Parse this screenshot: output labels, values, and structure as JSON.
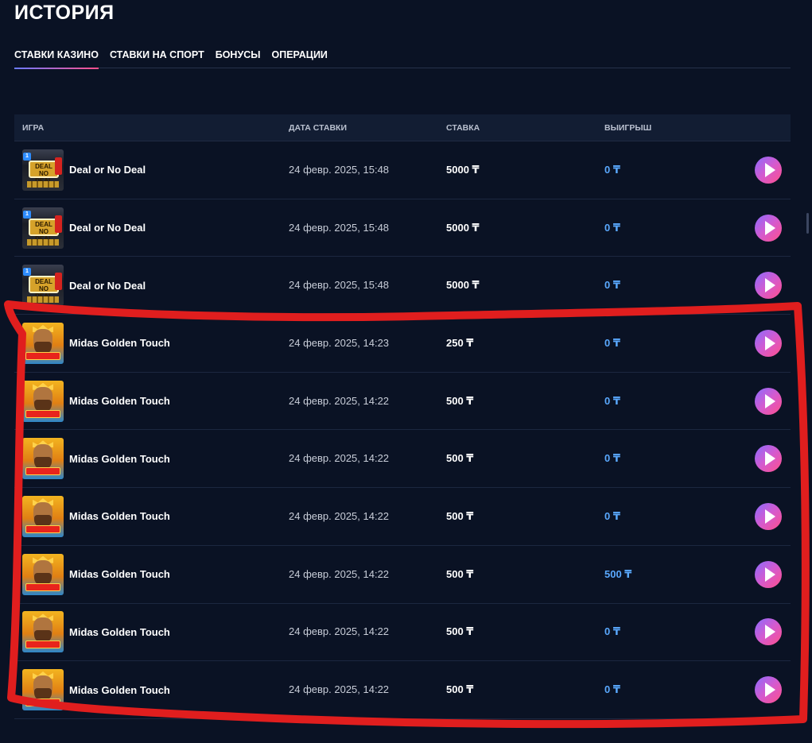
{
  "page": {
    "title": "ИСТОРИЯ"
  },
  "tabs": [
    {
      "label": "СТАВКИ КАЗИНО",
      "active": true
    },
    {
      "label": "СТАВКИ НА СПОРТ",
      "active": false
    },
    {
      "label": "БОНУСЫ",
      "active": false
    },
    {
      "label": "ОПЕРАЦИИ",
      "active": false
    }
  ],
  "table": {
    "headers": {
      "game": "ИГРА",
      "date": "ДАТА СТАВКИ",
      "bet": "СТАВКА",
      "win": "ВЫИГРЫШ"
    },
    "rows": [
      {
        "thumb": "deal-or-no-deal-thumbnail",
        "game": "Deal or No Deal",
        "date": "24 февр. 2025, 15:48",
        "bet": "5000 ₸",
        "win": "0 ₸"
      },
      {
        "thumb": "deal-or-no-deal-thumbnail",
        "game": "Deal or No Deal",
        "date": "24 февр. 2025, 15:48",
        "bet": "5000 ₸",
        "win": "0 ₸"
      },
      {
        "thumb": "deal-or-no-deal-thumbnail",
        "game": "Deal or No Deal",
        "date": "24 февр. 2025, 15:48",
        "bet": "5000 ₸",
        "win": "0 ₸"
      },
      {
        "thumb": "midas-golden-touch-thumbnail",
        "game": "Midas Golden Touch",
        "date": "24 февр. 2025, 14:23",
        "bet": "250 ₸",
        "win": "0 ₸"
      },
      {
        "thumb": "midas-golden-touch-thumbnail",
        "game": "Midas Golden Touch",
        "date": "24 февр. 2025, 14:22",
        "bet": "500 ₸",
        "win": "0 ₸"
      },
      {
        "thumb": "midas-golden-touch-thumbnail",
        "game": "Midas Golden Touch",
        "date": "24 февр. 2025, 14:22",
        "bet": "500 ₸",
        "win": "0 ₸"
      },
      {
        "thumb": "midas-golden-touch-thumbnail",
        "game": "Midas Golden Touch",
        "date": "24 февр. 2025, 14:22",
        "bet": "500 ₸",
        "win": "0 ₸"
      },
      {
        "thumb": "midas-golden-touch-thumbnail",
        "game": "Midas Golden Touch",
        "date": "24 февр. 2025, 14:22",
        "bet": "500 ₸",
        "win": "500 ₸"
      },
      {
        "thumb": "midas-golden-touch-thumbnail",
        "game": "Midas Golden Touch",
        "date": "24 февр. 2025, 14:22",
        "bet": "500 ₸",
        "win": "0 ₸"
      },
      {
        "thumb": "midas-golden-touch-thumbnail",
        "game": "Midas Golden Touch",
        "date": "24 февр. 2025, 14:22",
        "bet": "500 ₸",
        "win": "0 ₸"
      }
    ]
  },
  "icons": {
    "play": "play-icon"
  },
  "colors": {
    "background": "#0a1224",
    "header_row": "#121d33",
    "win_text": "#5aa9ff",
    "play_gradient_start": "#8a6bff",
    "play_gradient_end": "#ff4f8b",
    "annotation_stroke": "#e01e1e"
  }
}
